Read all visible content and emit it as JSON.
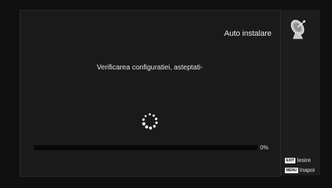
{
  "header": {
    "title": "Auto instalare",
    "icon": "satellite-dish-icon"
  },
  "main": {
    "message": "Verificarea configuratiei, asteptati-"
  },
  "progress": {
    "percent_label": "0%",
    "value": 0
  },
  "footer": {
    "exit_key": "EXIT",
    "exit_label": "Iesire",
    "menu_key": "MENU",
    "menu_label": "Inapoi"
  },
  "colors": {
    "background": "#101010",
    "panel": "#1a1a1a",
    "text": "#e6e6e6"
  }
}
